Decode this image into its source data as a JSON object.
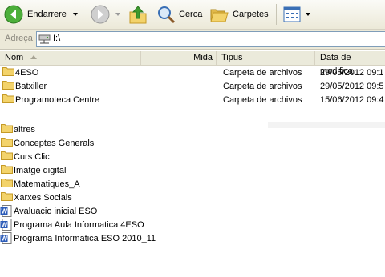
{
  "toolbar": {
    "back_label": "Endarrere",
    "search_label": "Cerca",
    "folders_label": "Carpetes"
  },
  "address": {
    "label": "Adreça",
    "value": "I:\\"
  },
  "columns": {
    "name": "Nom",
    "size": "Mida",
    "type": "Tipus",
    "date": "Data de modifica"
  },
  "details_rows": [
    {
      "name": "4ESO",
      "type": "Carpeta de archivos",
      "date": "29/05/2012 09:1"
    },
    {
      "name": "Batxiller",
      "type": "Carpeta de archivos",
      "date": "29/05/2012 09:5"
    },
    {
      "name": "Programoteca Centre",
      "type": "Carpeta de archivos",
      "date": "15/06/2012 09:4"
    }
  ],
  "list_items": [
    {
      "name": "altres",
      "icon": "folder-icon"
    },
    {
      "name": "Conceptes Generals",
      "icon": "folder-icon"
    },
    {
      "name": "Curs Clic",
      "icon": "folder-icon"
    },
    {
      "name": "Imatge digital",
      "icon": "folder-icon"
    },
    {
      "name": "Matematiques_A",
      "icon": "folder-icon"
    },
    {
      "name": "Xarxes Socials",
      "icon": "folder-icon"
    },
    {
      "name": "Avaluacio inicial ESO",
      "icon": "word-document-icon"
    },
    {
      "name": "Programa Aula Informatica 4ESO",
      "icon": "word-document-icon"
    },
    {
      "name": "Programa Informatica ESO 2010_11",
      "icon": "word-document-icon"
    }
  ],
  "colors": {
    "folder": "#f3d36b",
    "folder_edge": "#c59a26",
    "word_blue": "#2b5bb8",
    "back_green": "#3f9a2e"
  }
}
